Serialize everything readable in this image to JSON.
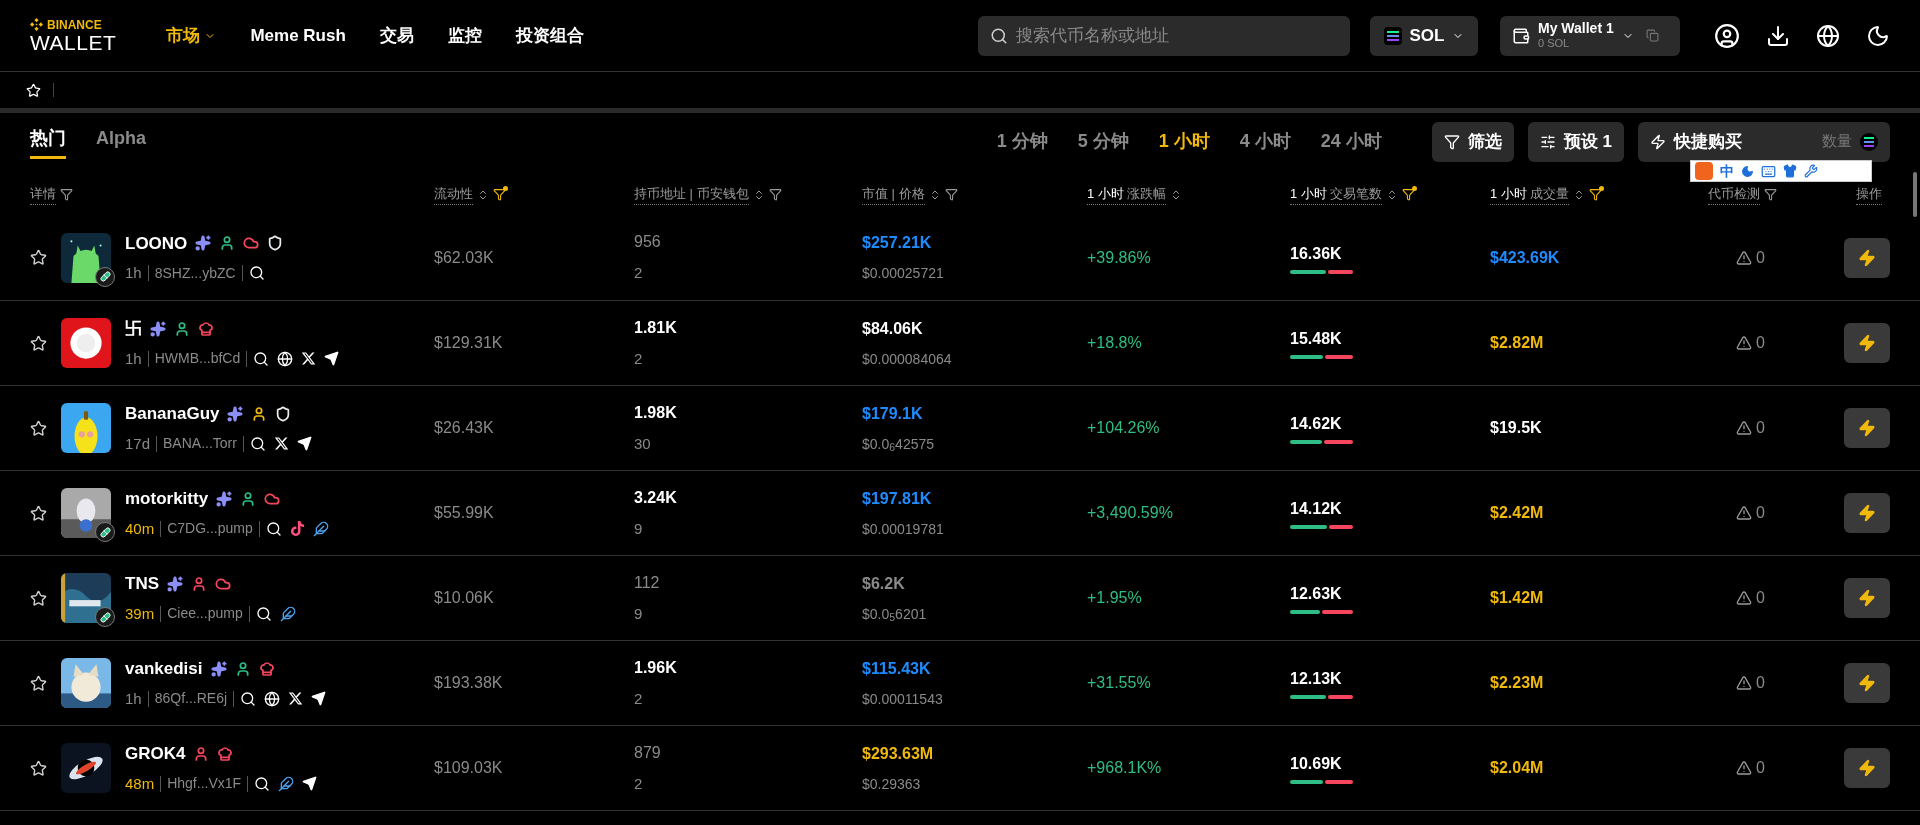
{
  "logo": {
    "top": "BINANCE",
    "bottom": "WALLET"
  },
  "nav": [
    {
      "label": "市场",
      "selected": true,
      "dropdown": true
    },
    {
      "label": "Meme Rush",
      "selected": false,
      "dropdown": false
    },
    {
      "label": "交易",
      "selected": false,
      "dropdown": false
    },
    {
      "label": "监控",
      "selected": false,
      "dropdown": false
    },
    {
      "label": "投资组合",
      "selected": false,
      "dropdown": false
    }
  ],
  "search": {
    "placeholder": "搜索代币名称或地址"
  },
  "chain": {
    "label": "SOL"
  },
  "wallet": {
    "name": "My Wallet 1",
    "balance": "0 SOL"
  },
  "tabs": [
    {
      "label": "热门",
      "selected": true
    },
    {
      "label": "Alpha",
      "selected": false
    }
  ],
  "timeframes": [
    {
      "label": "1 分钟",
      "selected": false
    },
    {
      "label": "5 分钟",
      "selected": false
    },
    {
      "label": "1 小时",
      "selected": true
    },
    {
      "label": "4 小时",
      "selected": false
    },
    {
      "label": "24 小时",
      "selected": false
    }
  ],
  "toolbar": {
    "filter": "筛选",
    "preset": "预设 1",
    "quick_buy": "快捷购买",
    "amount": "数量"
  },
  "ime_toolbar": {
    "mode": "中"
  },
  "columns": [
    {
      "label": "详情",
      "sort": false,
      "filter": true,
      "filter_active": false
    },
    {
      "label": "流动性",
      "sort": true,
      "filter": true,
      "filter_active": true
    },
    {
      "label": "持币地址 | 币安钱包",
      "sort": true,
      "filter": true,
      "filter_active": false
    },
    {
      "label": "市值 | 价格",
      "sort": true,
      "filter": true,
      "filter_active": false
    },
    {
      "prefix": "1 小时",
      "label": "涨跌幅",
      "sort": true,
      "filter": false
    },
    {
      "prefix": "1 小时",
      "label": "交易笔数",
      "sort": true,
      "filter": true,
      "filter_active": true
    },
    {
      "prefix": "1 小时",
      "label": "成交量",
      "sort": true,
      "filter": true,
      "filter_active": true
    },
    {
      "label": "代币检测",
      "sort": false,
      "filter": true,
      "filter_active": false
    },
    {
      "label": "操作",
      "sort": false,
      "filter": false
    }
  ],
  "rows": [
    {
      "name": "LOONO",
      "pill": true,
      "tags": [
        {
          "kind": "sparkle",
          "color": "#8b8ff7"
        },
        {
          "kind": "person",
          "color": "#2ebd85"
        },
        {
          "kind": "cloud",
          "color": "#f6465d"
        },
        {
          "kind": "shield",
          "color": "#eaecef"
        }
      ],
      "age": "1h",
      "recent": false,
      "address": "8SHZ...ybZC",
      "links": [
        {
          "kind": "search"
        }
      ],
      "liquidity": "$62.03K",
      "holders": "956",
      "holders_bright": false,
      "wallets": "2",
      "mcap": {
        "text": "$257.21K",
        "color": "#1e8cff"
      },
      "price": "$0.00025721",
      "change": "+39.86%",
      "txns": "16.36K",
      "level": 0.57,
      "volume": {
        "text": "$423.69K",
        "color": "#1e8cff"
      },
      "risk": "0"
    },
    {
      "name": "卐",
      "pill": false,
      "tags": [
        {
          "kind": "sparkle",
          "color": "#8b8ff7"
        },
        {
          "kind": "person",
          "color": "#2ebd85"
        },
        {
          "kind": "chef",
          "color": "#f6465d"
        }
      ],
      "age": "1h",
      "recent": false,
      "address": "HWMB...bfCd",
      "links": [
        {
          "kind": "search"
        },
        {
          "kind": "globe"
        },
        {
          "kind": "x"
        },
        {
          "kind": "telegram"
        }
      ],
      "liquidity": "$129.31K",
      "holders": "1.81K",
      "holders_bright": true,
      "wallets": "2",
      "mcap": {
        "text": "$84.06K",
        "color": "#ffffff"
      },
      "price": "$0.000084064",
      "change": "+18.8%",
      "txns": "15.48K",
      "level": 0.53,
      "volume": {
        "text": "$2.82M",
        "color": "#f0b90b"
      },
      "risk": "0"
    },
    {
      "name": "BananaGuy",
      "pill": false,
      "tags": [
        {
          "kind": "sparkle",
          "color": "#8b8ff7"
        },
        {
          "kind": "person",
          "color": "#f0b90b"
        },
        {
          "kind": "shield",
          "color": "#eaecef"
        }
      ],
      "age": "17d",
      "recent": false,
      "address": "BANA...Torr",
      "links": [
        {
          "kind": "search"
        },
        {
          "kind": "x"
        },
        {
          "kind": "telegram"
        }
      ],
      "liquidity": "$26.43K",
      "holders": "1.98K",
      "holders_bright": true,
      "wallets": "30",
      "mcap": {
        "text": "$179.1K",
        "color": "#1e8cff"
      },
      "price": "$0.0$_{6}$42575",
      "change": "+104.26%",
      "txns": "14.62K",
      "level": 0.5,
      "volume": {
        "text": "$19.5K",
        "color": "#ffffff"
      },
      "risk": "0"
    },
    {
      "name": "motorkitty",
      "pill": true,
      "tags": [
        {
          "kind": "sparkle",
          "color": "#8b8ff7"
        },
        {
          "kind": "person",
          "color": "#2ebd85"
        },
        {
          "kind": "cloud",
          "color": "#f6465d"
        }
      ],
      "age": "40m",
      "recent": true,
      "address": "C7DG...pump",
      "links": [
        {
          "kind": "search"
        },
        {
          "kind": "tiktok"
        },
        {
          "kind": "feather"
        }
      ],
      "liquidity": "$55.99K",
      "holders": "3.24K",
      "holders_bright": true,
      "wallets": "9",
      "mcap": {
        "text": "$197.81K",
        "color": "#1e8cff"
      },
      "price": "$0.00019781",
      "change": "+3,490.59%",
      "txns": "14.12K",
      "level": 0.58,
      "volume": {
        "text": "$2.42M",
        "color": "#f0b90b"
      },
      "risk": "0"
    },
    {
      "name": "TNS",
      "pill": true,
      "tags": [
        {
          "kind": "sparkle",
          "color": "#8b8ff7"
        },
        {
          "kind": "person",
          "color": "#f6465d"
        },
        {
          "kind": "cloud",
          "color": "#f6465d"
        }
      ],
      "age": "39m",
      "recent": true,
      "address": "Ciee...pump",
      "links": [
        {
          "kind": "search"
        },
        {
          "kind": "feather"
        }
      ],
      "liquidity": "$10.06K",
      "holders": "112",
      "holders_bright": false,
      "wallets": "9",
      "mcap": {
        "text": "$6.2K",
        "color": "#8a8a8a"
      },
      "price": "$0.0$_{5}$6201",
      "change": "+1.95%",
      "txns": "12.63K",
      "level": 0.47,
      "volume": {
        "text": "$1.42M",
        "color": "#f0b90b"
      },
      "risk": "0"
    },
    {
      "name": "vankedisi",
      "pill": false,
      "tags": [
        {
          "kind": "sparkle",
          "color": "#8b8ff7"
        },
        {
          "kind": "person",
          "color": "#2ebd85"
        },
        {
          "kind": "chef",
          "color": "#f6465d"
        }
      ],
      "age": "1h",
      "recent": false,
      "address": "86Qf...RE6j",
      "links": [
        {
          "kind": "search"
        },
        {
          "kind": "globe"
        },
        {
          "kind": "x"
        },
        {
          "kind": "telegram"
        }
      ],
      "liquidity": "$193.38K",
      "holders": "1.96K",
      "holders_bright": true,
      "wallets": "2",
      "mcap": {
        "text": "$115.43K",
        "color": "#1e8cff"
      },
      "price": "$0.00011543",
      "change": "+31.55%",
      "txns": "12.13K",
      "level": 0.57,
      "volume": {
        "text": "$2.23M",
        "color": "#f0b90b"
      },
      "risk": "0"
    },
    {
      "name": "GROK4",
      "pill": false,
      "tags": [
        {
          "kind": "person",
          "color": "#f6465d"
        },
        {
          "kind": "chef",
          "color": "#f6465d"
        }
      ],
      "age": "48m",
      "recent": true,
      "address": "Hhgf...Vx1F",
      "links": [
        {
          "kind": "search"
        },
        {
          "kind": "feather"
        },
        {
          "kind": "telegram"
        }
      ],
      "liquidity": "$109.03K",
      "holders": "879",
      "holders_bright": false,
      "wallets": "2",
      "mcap": {
        "text": "$293.63M",
        "color": "#f0b90b"
      },
      "price": "$0.29363",
      "change": "+968.1K%",
      "txns": "10.69K",
      "level": 0.53,
      "volume": {
        "text": "$2.04M",
        "color": "#f0b90b"
      },
      "risk": "0"
    }
  ]
}
